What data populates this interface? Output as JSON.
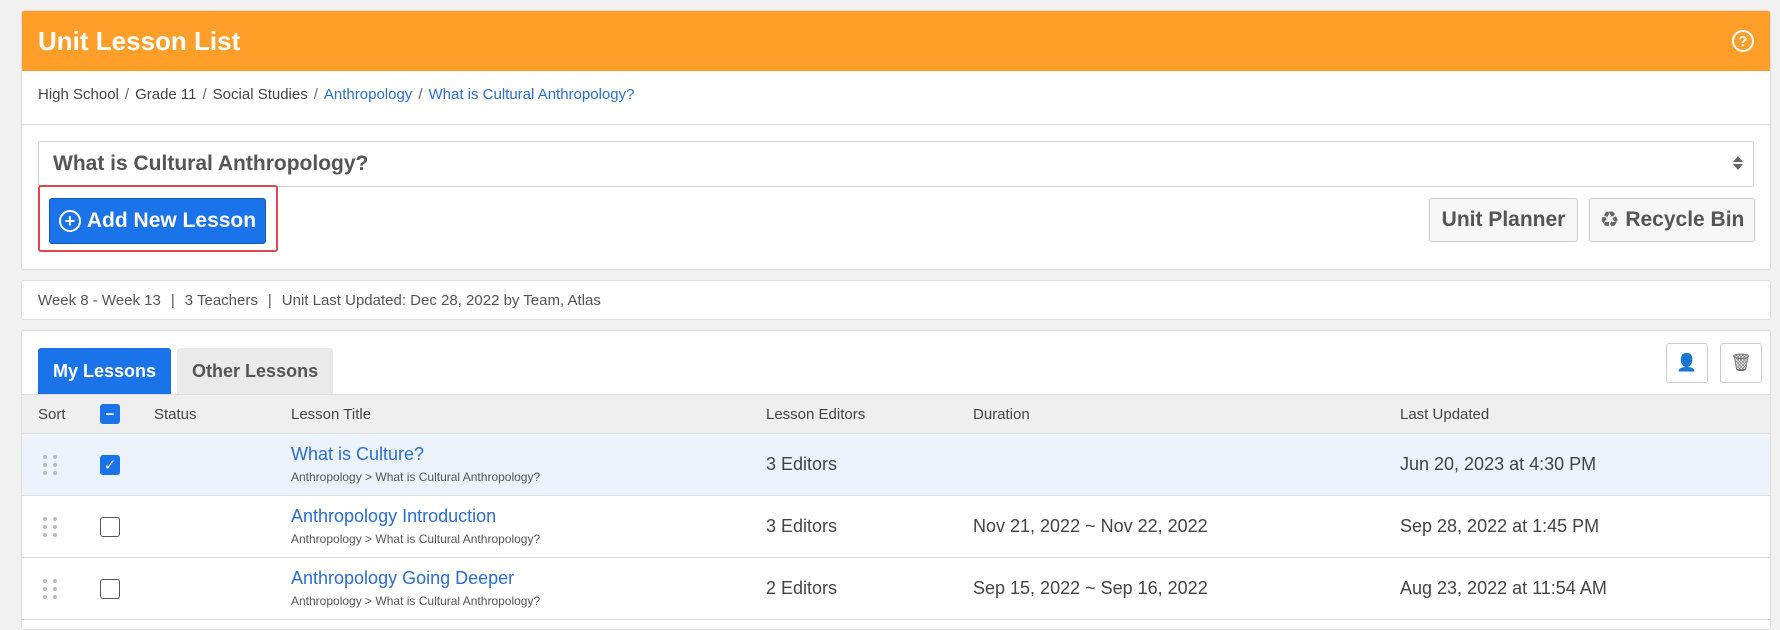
{
  "header": {
    "title": "Unit Lesson List",
    "help_icon": "?"
  },
  "breadcrumb": [
    {
      "label": "High School",
      "link": false
    },
    {
      "label": "Grade 11",
      "link": false
    },
    {
      "label": "Social Studies",
      "link": false
    },
    {
      "label": "Anthropology",
      "link": true
    },
    {
      "label": "What is Cultural Anthropology?",
      "link": true
    }
  ],
  "breadcrumb_sep": "/",
  "unit_select": {
    "value": "What is Cultural Anthropology?"
  },
  "buttons": {
    "add_lesson": "Add New Lesson",
    "unit_planner": "Unit Planner",
    "recycle_bin": "Recycle Bin"
  },
  "meta": {
    "weeks": "Week 8 - Week 13",
    "teachers": "3 Teachers",
    "updated": "Unit Last Updated: Dec 28, 2022 by Team, Atlas",
    "sep": "|"
  },
  "tabs": [
    {
      "label": "My Lessons",
      "active": true
    },
    {
      "label": "Other Lessons",
      "active": false
    }
  ],
  "table": {
    "headers": {
      "sort": "Sort",
      "status": "Status",
      "title": "Lesson Title",
      "editors": "Lesson Editors",
      "duration": "Duration",
      "updated": "Last Updated"
    },
    "rows": [
      {
        "title": "What is Culture?",
        "path": "Anthropology > What is Cultural Anthropology?",
        "editors": "3 Editors",
        "duration": "",
        "updated": "Jun 20, 2023 at 4:30 PM",
        "checked": true
      },
      {
        "title": "Anthropology Introduction",
        "path": "Anthropology > What is Cultural Anthropology?",
        "editors": "3 Editors",
        "duration": "Nov 21, 2022 ~ Nov 22, 2022",
        "updated": "Sep 28, 2022 at 1:45 PM",
        "checked": false
      },
      {
        "title": "Anthropology Going Deeper",
        "path": "Anthropology > What is Cultural Anthropology?",
        "editors": "2 Editors",
        "duration": "Sep 15, 2022 ~ Sep 16, 2022",
        "updated": "Aug 23, 2022 at 11:54 AM",
        "checked": false
      }
    ]
  },
  "colors": {
    "header": "#ff9f2a",
    "accent": "#1a73e8",
    "link": "#2b6dd1",
    "highlight": "#e0474c"
  }
}
